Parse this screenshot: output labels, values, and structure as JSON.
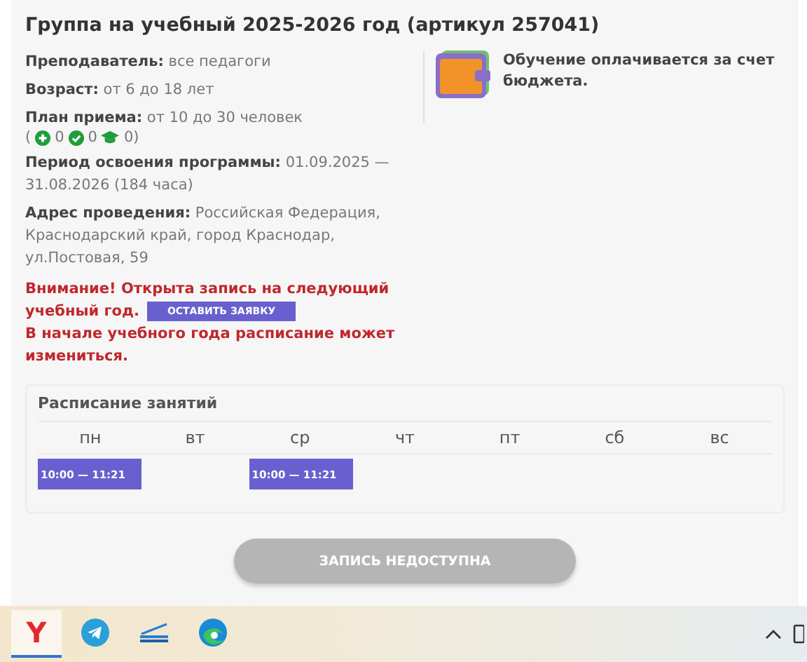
{
  "title": "Группа на учебный 2025-2026 год (артикул 257041)",
  "info": [
    "**Преподаватель:** все педагоги",
    "**Возраст:** от 6 до 18 лет",
    "**План приема:** от 10 до 30 человек"
  ],
  "counts": {
    "open": "(",
    "close": ")",
    "items": [
      {
        "kind": "plus",
        "value": "0"
      },
      {
        "kind": "check",
        "value": "0"
      },
      {
        "kind": "cap",
        "value": "0"
      }
    ]
  },
  "info_after": [
    "**Период освоения программы:** 01.09.2025 — 31.08.2026 (184 часа)",
    "**Адрес проведения:** Российская Федерация, Краснодарский край, город Краснодар, ул.Постовая, 59"
  ],
  "payment": "Обучение оплачивается за счет бюджета.",
  "warning": {
    "lead": "Внимание! Открыта запись на следующий учебный год.",
    "button": "ОСТАВИТЬ ЗАЯВКУ",
    "tail": "В начале учебного года расписание может измениться."
  },
  "schedule": {
    "title": "Расписание занятий",
    "days": [
      {
        "day": "пн",
        "slot": "10:00 — 11:21"
      },
      {
        "day": "вт"
      },
      {
        "day": "ср",
        "slot": "10:00 — 11:21"
      },
      {
        "day": "чт"
      },
      {
        "day": "пт"
      },
      {
        "day": "сб"
      },
      {
        "day": "вс"
      }
    ]
  },
  "enroll_button": {
    "label": "ЗАПИСЬ НЕДОСТУПНА",
    "disabled": true
  },
  "taskbar": {
    "apps": [
      {
        "kind": "yandex",
        "letter": "Y",
        "selected": true
      },
      {
        "kind": "telegram",
        "selected": false
      },
      {
        "kind": "scanner",
        "selected": false
      },
      {
        "kind": "edge",
        "selected": false
      }
    ]
  }
}
